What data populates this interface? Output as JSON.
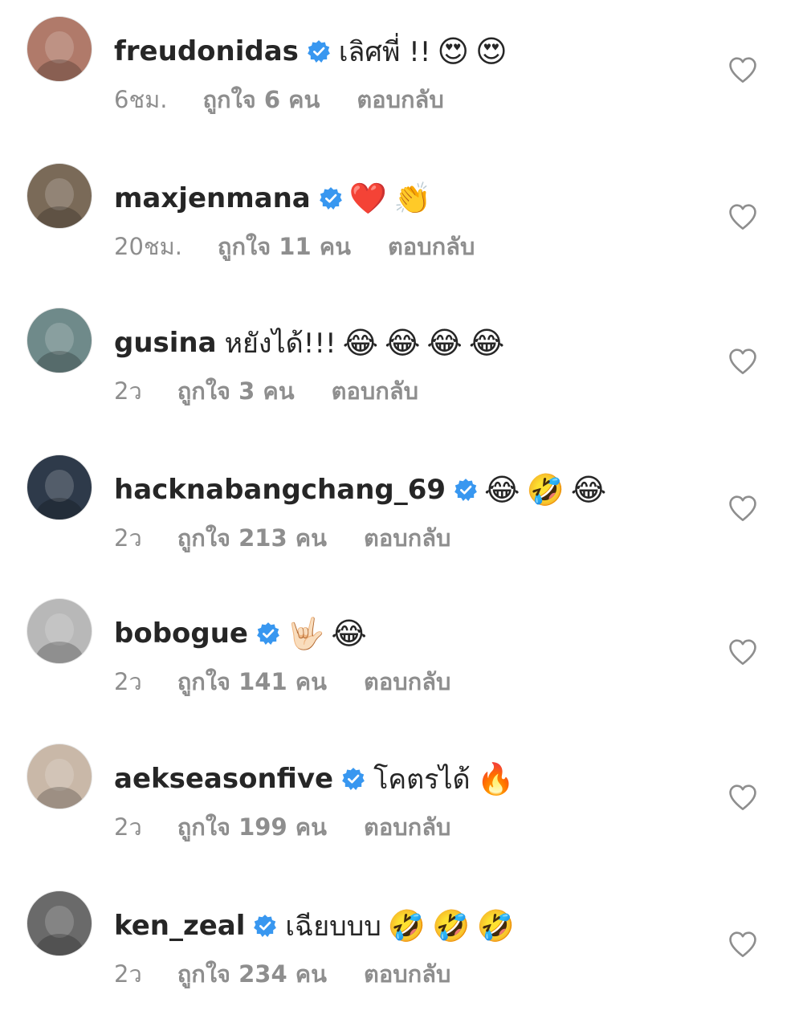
{
  "comments": [
    {
      "username": "freudonidas",
      "verified": true,
      "text": "เลิศพี่ !!",
      "emojis": [
        "😍",
        "😍"
      ],
      "time": "6ชม.",
      "likes": "ถูกใจ 6 คน",
      "reply": "ตอบกลับ",
      "avatar_color": "#b07a6a"
    },
    {
      "username": "maxjenmana",
      "verified": true,
      "text": "",
      "emojis": [
        "❤️",
        "👏"
      ],
      "time": "20ชม.",
      "likes": "ถูกใจ 11 คน",
      "reply": "ตอบกลับ",
      "avatar_color": "#7a6a58"
    },
    {
      "username": "gusina",
      "verified": false,
      "text": "หยังได้!!!",
      "emojis": [
        "😂",
        "😂",
        "😂",
        "😂"
      ],
      "time": "2ว",
      "likes": "ถูกใจ 3 คน",
      "reply": "ตอบกลับ",
      "avatar_color": "#6f8a8a"
    },
    {
      "username": "hacknabangchang_69",
      "verified": true,
      "text": "",
      "emojis": [
        "😂",
        "🤣",
        "😂"
      ],
      "time": "2ว",
      "likes": "ถูกใจ 213 คน",
      "reply": "ตอบกลับ",
      "avatar_color": "#2e3a4a"
    },
    {
      "username": "bobogue",
      "verified": true,
      "text": "",
      "emojis": [
        "🤟🏻",
        "😂"
      ],
      "time": "2ว",
      "likes": "ถูกใจ 141 คน",
      "reply": "ตอบกลับ",
      "avatar_color": "#b8b8b8"
    },
    {
      "username": "aekseasonfive",
      "verified": true,
      "text": "โคตรได้",
      "emojis": [
        "🔥"
      ],
      "time": "2ว",
      "likes": "ถูกใจ 199 คน",
      "reply": "ตอบกลับ",
      "avatar_color": "#c9b8a8"
    },
    {
      "username": "ken_zeal",
      "verified": true,
      "text": "เฉียบบบ",
      "emojis": [
        "🤣",
        "🤣",
        "🤣"
      ],
      "time": "2ว",
      "likes": "ถูกใจ 234 คน",
      "reply": "ตอบกลับ",
      "avatar_color": "#6a6a6a"
    }
  ],
  "colors": {
    "username": "#262626",
    "meta": "#8e8e8e",
    "verified_badge": "#3897f0",
    "heart_outline": "#8e8e8e"
  },
  "icons": {
    "verified": "verified-badge-icon",
    "like": "heart-outline-icon"
  }
}
